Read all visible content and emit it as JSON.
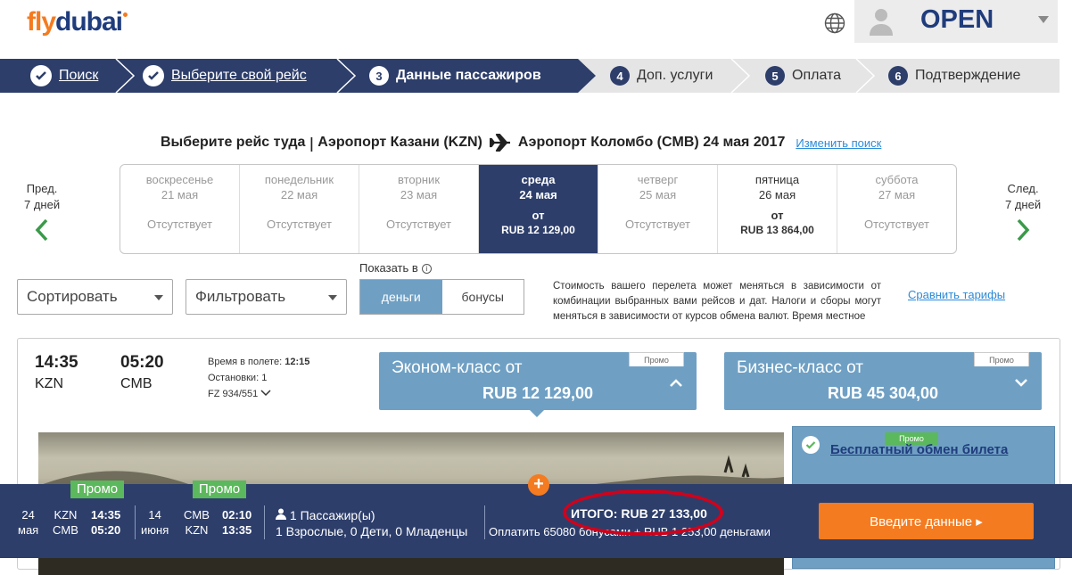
{
  "header": {
    "logo": {
      "fly": "fly",
      "dubai": "dubai"
    },
    "account_label": "OPEN"
  },
  "steps": [
    {
      "label": "Поиск",
      "state": "done"
    },
    {
      "label": "Выберите свой рейс",
      "state": "done"
    },
    {
      "num": "3",
      "label": "Данные пассажиров",
      "state": "current"
    },
    {
      "num": "4",
      "label": "Доп. услуги",
      "state": "todo"
    },
    {
      "num": "5",
      "label": "Оплата",
      "state": "todo"
    },
    {
      "num": "6",
      "label": "Подтверждение",
      "state": "todo"
    }
  ],
  "route": {
    "prefix": "Выберите рейс туда",
    "sep": "|",
    "origin": "Аэропорт Казани (KZN)",
    "destination": "Аэропорт Коломбо (CMB)",
    "date": "24 мая 2017",
    "change_link": "Изменить поиск"
  },
  "prev_nav": {
    "line1": "Пред.",
    "line2": "7 дней"
  },
  "next_nav": {
    "line1": "След.",
    "line2": "7 дней"
  },
  "dates": [
    {
      "day": "воскресенье",
      "date": "21 мая",
      "status": "Отсутствует"
    },
    {
      "day": "понедельник",
      "date": "22 мая",
      "status": "Отсутствует"
    },
    {
      "day": "вторник",
      "date": "23 мая",
      "status": "Отсутствует"
    },
    {
      "day": "среда",
      "date": "24 мая",
      "from": "от",
      "price": "RUB 12 129,00"
    },
    {
      "day": "четверг",
      "date": "25 мая",
      "status": "Отсутствует"
    },
    {
      "day": "пятница",
      "date": "26 мая",
      "from": "от",
      "price": "RUB 13 864,00"
    },
    {
      "day": "суббота",
      "date": "27 мая",
      "status": "Отсутствует"
    }
  ],
  "controls": {
    "sort": "Сортировать",
    "filter": "Фильтровать",
    "show_in": "Показать в",
    "info_icon": "i",
    "money": "деньги",
    "bonus": "бонусы",
    "note": "Стоимость вашего перелета может меняться в зависимости от комбинации выбранных вами рейсов и дат. Налоги и сборы могут меняться в зависимости от курсов обмена валют. Время местное",
    "compare": "Сравнить тарифы"
  },
  "flight": {
    "dep_time": "14:35",
    "dep_code": "KZN",
    "arr_time": "05:20",
    "arr_code": "CMB",
    "duration_label": "Время в полете:",
    "duration": "12:15",
    "stops": "Остановки: 1",
    "flight_no": "FZ 934/551",
    "economy": {
      "title": "Эконом-класс от",
      "price": "RUB 12 129,00",
      "promo": "Промо"
    },
    "business": {
      "title": "Бизнес-класс от",
      "price": "RUB 45 304,00",
      "promo": "Промо"
    },
    "side": {
      "promo": "Промо",
      "link": "Бесплатный обмен билета"
    }
  },
  "summary": {
    "plus": "+",
    "out": {
      "promo": "Промо",
      "day": "24",
      "month": "мая",
      "from": "KZN",
      "to": "CMB",
      "dep": "14:35",
      "arr": "05:20"
    },
    "ret": {
      "promo": "Промо",
      "day": "14",
      "month": "июня",
      "from": "CMB",
      "to": "KZN",
      "dep": "02:10",
      "arr": "13:35"
    },
    "pax_line1": "1 Пассажир(ы)",
    "pax_line2": "1 Взрослые, 0 Дети, 0 Младенцы",
    "total": "ИТОГО: RUB 27 133,00",
    "pay": "Оплатить 65080 бонусами + RUB 1 253,00 деньгами",
    "cta": "Введите данные ▸"
  },
  "colors": {
    "navy": "#2d3e6b",
    "orange": "#f47b20",
    "fare_blue": "#6fa0c4",
    "promo_green": "#5cb85c",
    "link_blue": "#2b8bd8",
    "highlight_red": "#d0021b"
  }
}
